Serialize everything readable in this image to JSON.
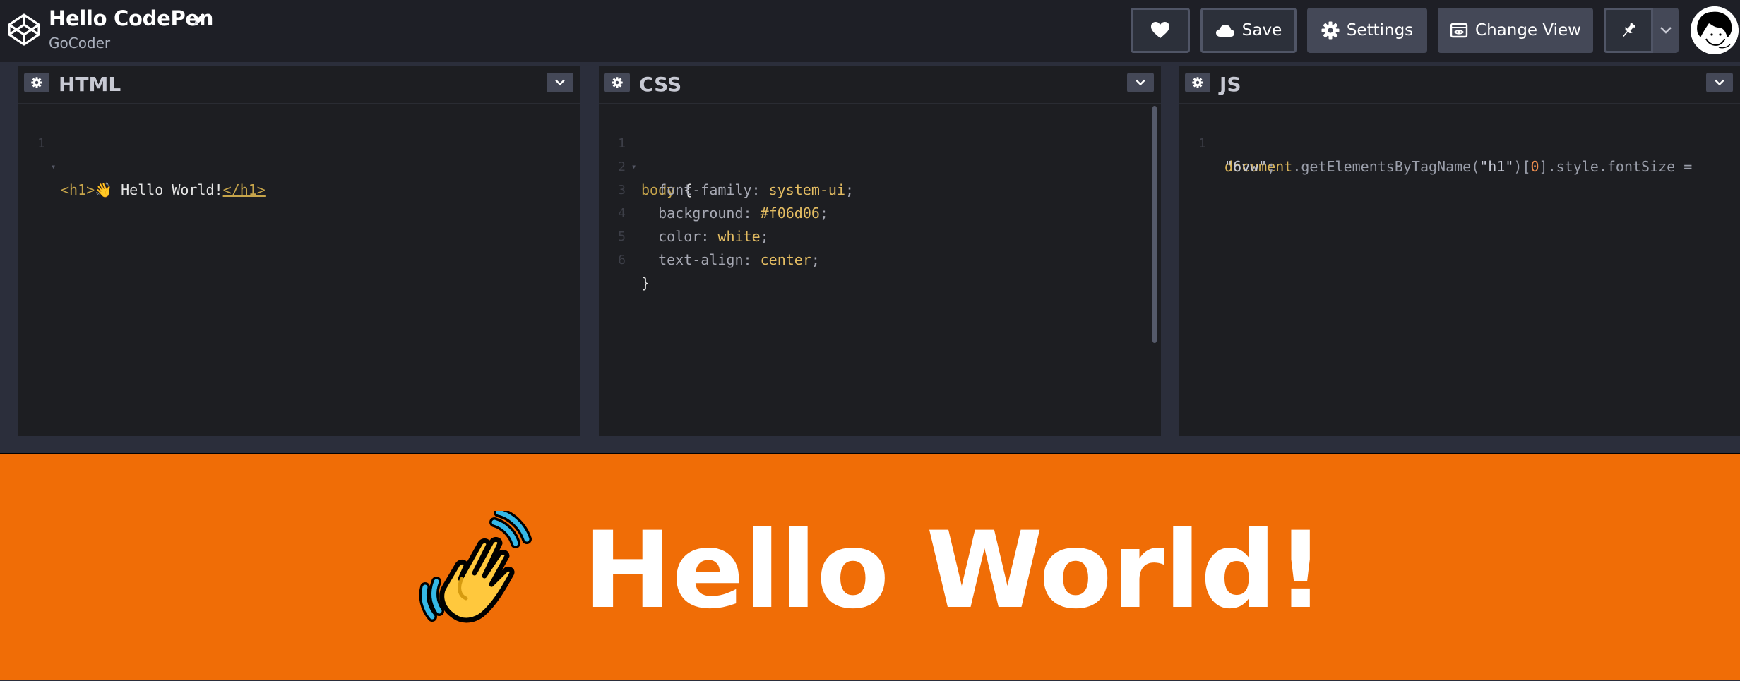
{
  "header": {
    "pen_title": "Hello CodePen",
    "owner": "GoCoder",
    "buttons": {
      "save": "Save",
      "settings": "Settings",
      "change_view": "Change View"
    }
  },
  "panels": {
    "html": {
      "title": "HTML",
      "lines": [
        {
          "n": "1",
          "open": "<h1>",
          "text": "👋 Hello World!",
          "close": "</h1>"
        }
      ]
    },
    "css": {
      "title": "CSS",
      "lines": [
        {
          "n": "1",
          "sel": "body",
          "brace": " {"
        },
        {
          "n": "2",
          "prop": "font-family",
          "val": "system-ui"
        },
        {
          "n": "3",
          "prop": "background",
          "val": "#f06d06"
        },
        {
          "n": "4",
          "prop": "color",
          "val": "white"
        },
        {
          "n": "5",
          "prop": "text-align",
          "val": "center"
        },
        {
          "n": "6",
          "brace": "}"
        }
      ]
    },
    "js": {
      "title": "JS",
      "line1": {
        "n": "1",
        "obj": "document",
        "method": ".getElementsByTagName(",
        "arg": "\"h1\"",
        "mid1": ")[",
        "idx": "0",
        "mid2": "].style.fontSize =",
        "value": "\"6vw\"",
        "end": ";"
      }
    }
  },
  "preview": {
    "heading": "Hello World!",
    "background": "#f06d06"
  },
  "colors": {
    "header_bg": "#1e1f26",
    "editor_bg": "#1d1e22",
    "button_bg": "#444857"
  }
}
